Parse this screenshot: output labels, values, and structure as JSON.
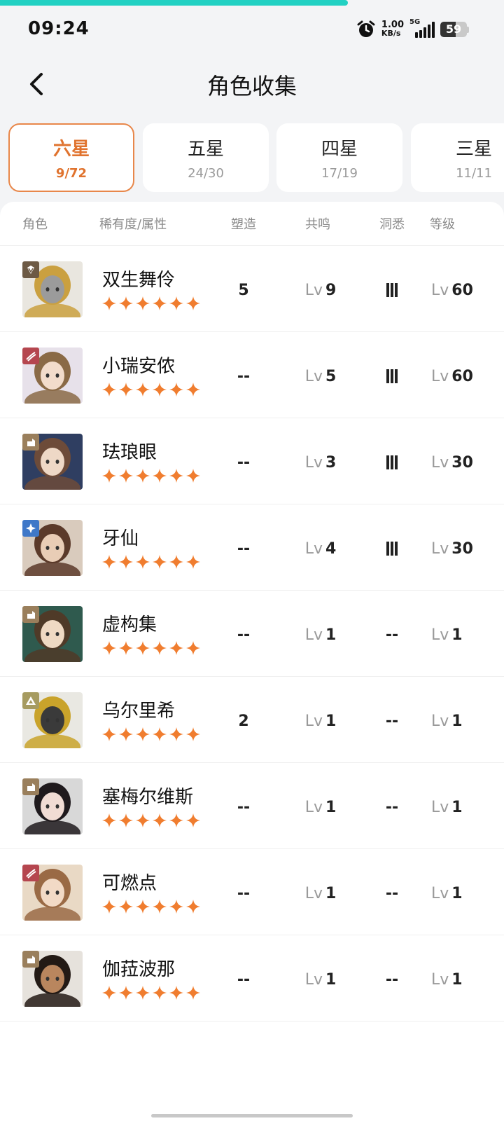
{
  "page_progress": 0.69,
  "status": {
    "time": "09:24",
    "net_speed_value": "1.00",
    "net_speed_unit": "KB/s",
    "network_type": "5G",
    "battery": "59"
  },
  "header": {
    "title": "角色收集"
  },
  "tabs": [
    {
      "name": "六星",
      "count": "9/72",
      "active": true
    },
    {
      "name": "五星",
      "count": "24/30",
      "active": false
    },
    {
      "name": "四星",
      "count": "17/19",
      "active": false
    },
    {
      "name": "三星",
      "count": "11/11",
      "active": false
    }
  ],
  "columns": {
    "character": "角色",
    "rarity": "稀有度/属性",
    "forge": "塑造",
    "resonance": "共鸣",
    "insight": "洞悉",
    "level": "等级"
  },
  "level_prefix": "Lv",
  "dash": "--",
  "colors": {
    "accent": "#e0732e",
    "star": "#f07d2f",
    "progress": "#22d1c3"
  },
  "characters": [
    {
      "name": "双生舞伶",
      "stars": 6,
      "attr": "beast",
      "attr_color": "#6d5a45",
      "forge": "5",
      "resonance": "9",
      "insight": "III",
      "level": "60",
      "hair": "#caa040",
      "skin": "#9b9b9b",
      "bg": "#e9e6df"
    },
    {
      "name": "小瑞安侬",
      "stars": 6,
      "attr": "intellect",
      "attr_color": "#b5464f",
      "forge": "--",
      "resonance": "5",
      "insight": "III",
      "level": "60",
      "hair": "#8a6a46",
      "skin": "#f2dccb",
      "bg": "#e7e1ea"
    },
    {
      "name": "珐琅眼",
      "stars": 6,
      "attr": "plant",
      "attr_color": "#9a7f5c",
      "forge": "--",
      "resonance": "3",
      "insight": "III",
      "level": "30",
      "hair": "#6d4b39",
      "skin": "#eed8c6",
      "bg": "#2f3e61"
    },
    {
      "name": "牙仙",
      "stars": 6,
      "attr": "spirit",
      "attr_color": "#3f78c8",
      "forge": "--",
      "resonance": "4",
      "insight": "III",
      "level": "30",
      "hair": "#5b3a2a",
      "skin": "#e9cdb6",
      "bg": "#d9cbbd"
    },
    {
      "name": "虚构集",
      "stars": 6,
      "attr": "plant",
      "attr_color": "#9a7f5c",
      "forge": "--",
      "resonance": "1",
      "insight": "--",
      "level": "1",
      "hair": "#4f3a28",
      "skin": "#efd9c3",
      "bg": "#2f5a4e"
    },
    {
      "name": "乌尔里希",
      "stars": 6,
      "attr": "mineral",
      "attr_color": "#a69b60",
      "forge": "2",
      "resonance": "1",
      "insight": "--",
      "level": "1",
      "hair": "#c9a32b",
      "skin": "#3a3a3a",
      "bg": "#e9e8e2"
    },
    {
      "name": "塞梅尔维斯",
      "stars": 6,
      "attr": "plant",
      "attr_color": "#9a7f5c",
      "forge": "--",
      "resonance": "1",
      "insight": "--",
      "level": "1",
      "hair": "#1f1a1d",
      "skin": "#f1dcd4",
      "bg": "#d8d8d8"
    },
    {
      "name": "可燃点",
      "stars": 6,
      "attr": "intellect",
      "attr_color": "#b5464f",
      "forge": "--",
      "resonance": "1",
      "insight": "--",
      "level": "1",
      "hair": "#9a6a45",
      "skin": "#f2dac6",
      "bg": "#e9d9c5"
    },
    {
      "name": "伽菈波那",
      "stars": 6,
      "attr": "plant",
      "attr_color": "#9a7f5c",
      "forge": "--",
      "resonance": "1",
      "insight": "--",
      "level": "1",
      "hair": "#231a15",
      "skin": "#b9865e",
      "bg": "#e6e2dc"
    }
  ]
}
